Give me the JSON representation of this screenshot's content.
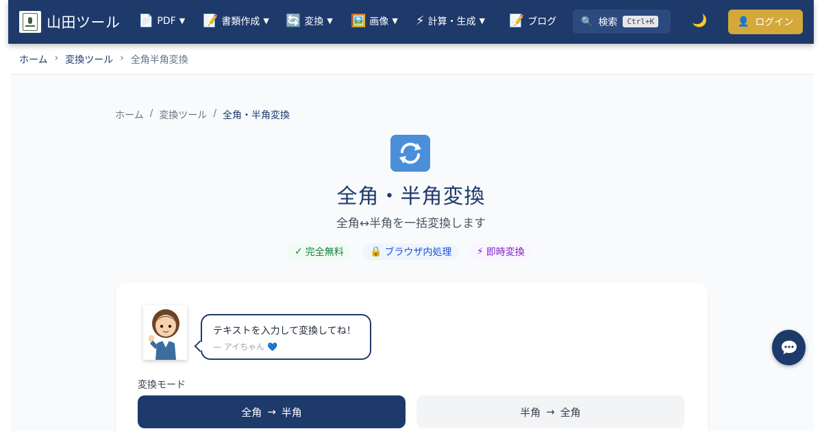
{
  "header": {
    "site_title": "山田ツール",
    "nav": [
      {
        "icon": "📄",
        "label": "PDF",
        "caret": "▼"
      },
      {
        "icon": "📝",
        "label": "書類作成",
        "caret": "▼"
      },
      {
        "icon": "🔄",
        "label": "変換",
        "caret": "▼"
      },
      {
        "icon": "🖼️",
        "label": "画像",
        "caret": "▼"
      },
      {
        "icon": "⚡",
        "label": "計算・生成",
        "caret": "▼"
      },
      {
        "icon": "📝",
        "label": "ブログ"
      }
    ],
    "search_label": "検索",
    "search_shortcut": "Ctrl+K",
    "theme_icon": "🌙",
    "login_label": "ログイン",
    "login_icon": "👤"
  },
  "breadcrumb_top": [
    "ホーム",
    "変換ツール",
    "全角半角変換"
  ],
  "breadcrumb_main": [
    "ホーム",
    "変換ツール",
    "全角・半角変換"
  ],
  "hero": {
    "icon": "🔄",
    "title": "全角・半角変換",
    "subtitle": "全角↔半角を一括変換します"
  },
  "badges": [
    {
      "icon": "✓",
      "label": "完全無料",
      "color": "#15803d"
    },
    {
      "icon": "🔒",
      "label": "ブラウザ内処理",
      "color": "#1d4ed8"
    },
    {
      "icon": "⚡",
      "label": "即時変換",
      "color": "#7e22ce"
    }
  ],
  "assistant": {
    "message": "テキストを入力して変換してね！",
    "signature": "— アイちゃん 💙"
  },
  "mode": {
    "label": "変換モード",
    "options": [
      {
        "from": "全角",
        "arrow": "→",
        "to": "半角",
        "active": true
      },
      {
        "from": "半角",
        "arrow": "→",
        "to": "全角",
        "active": false
      }
    ]
  },
  "colors": {
    "primary": "#1e3a6b",
    "accent": "#d4a93a",
    "background": "#f8fafc"
  }
}
